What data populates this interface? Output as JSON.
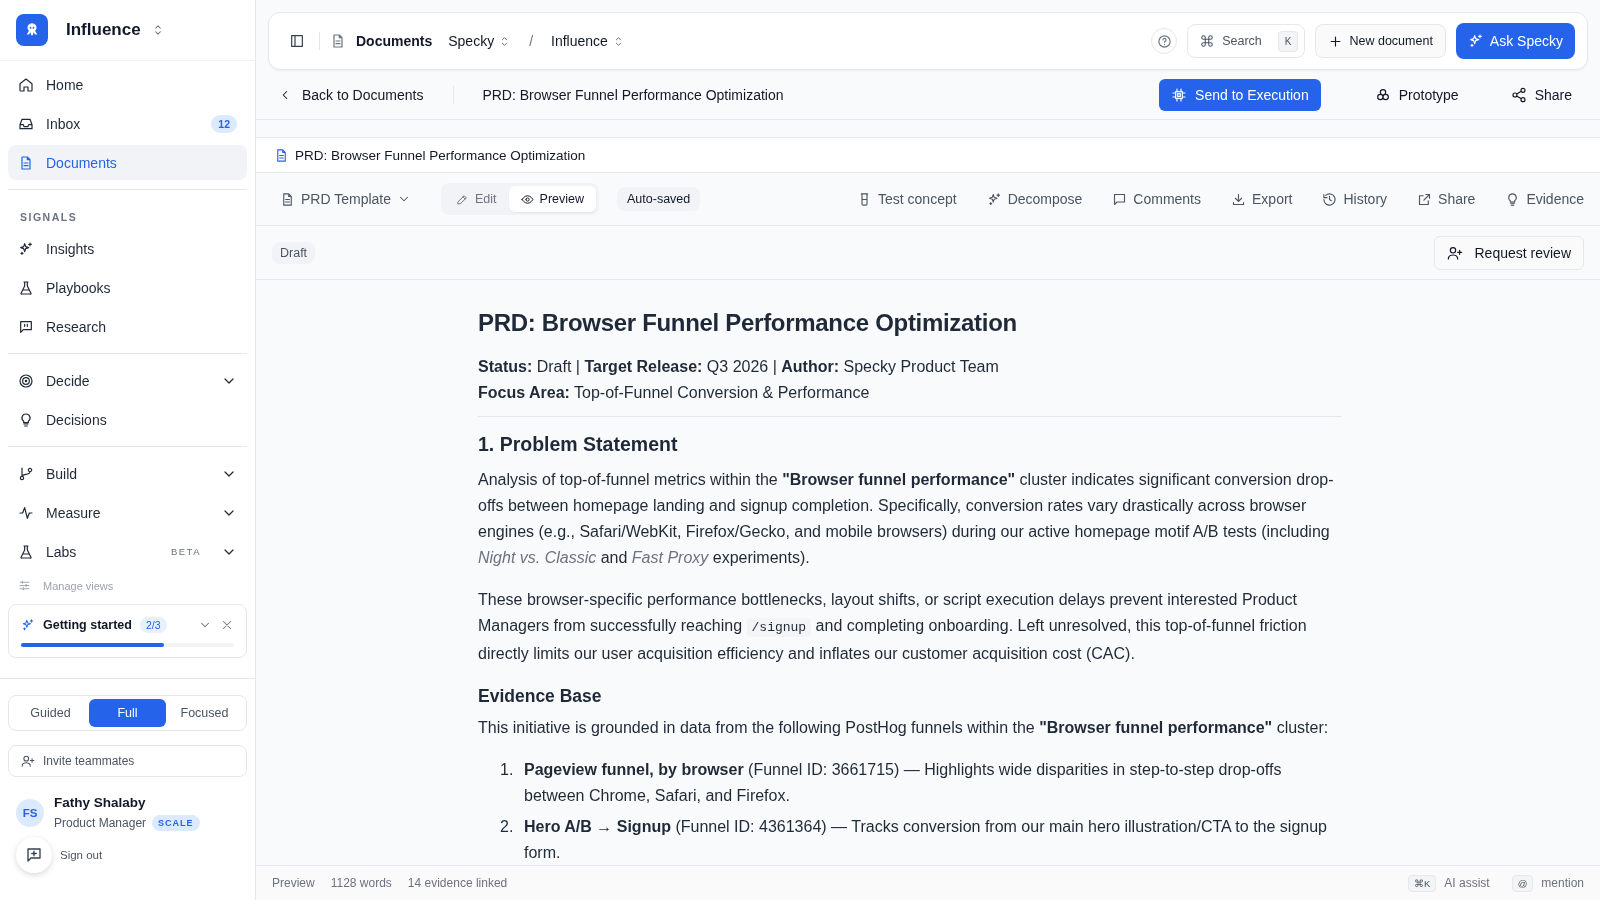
{
  "workspace": {
    "name": "Influence"
  },
  "sidebar": {
    "groups": [
      {
        "items": [
          {
            "label": "Home",
            "selected": false
          },
          {
            "label": "Inbox",
            "selected": false,
            "badge": "12"
          },
          {
            "label": "Documents",
            "selected": true
          }
        ]
      },
      {
        "heading": "SIGNALS",
        "items": [
          {
            "label": "Insights",
            "selected": false
          },
          {
            "label": "Playbooks",
            "selected": false
          },
          {
            "label": "Research",
            "selected": false
          }
        ]
      },
      {
        "items": [
          {
            "label": "Decide",
            "selected": false,
            "expandable": true
          },
          {
            "label": "Decisions",
            "selected": false
          }
        ]
      },
      {
        "items": [
          {
            "label": "Build",
            "selected": false,
            "expandable": true
          },
          {
            "label": "Measure",
            "selected": false,
            "expandable": true
          },
          {
            "label": "Labs",
            "selected": false,
            "expandable": true,
            "tag": "BETA"
          }
        ]
      }
    ],
    "manage_views": "Manage views",
    "getting_started": {
      "title": "Getting started",
      "count": "2/3",
      "level": 0.67
    },
    "view_modes": [
      {
        "label": "Guided",
        "selected": false
      },
      {
        "label": "Full",
        "selected": true
      },
      {
        "label": "Focused",
        "selected": false
      }
    ],
    "invite": "Invite teammates",
    "user": {
      "initials": "FS",
      "name": "Fathy Shalaby",
      "role": "Product Manager",
      "plan": "SCALE"
    },
    "sign_out": "Sign out"
  },
  "topbar": {
    "breadcrumb": [
      {
        "label": "Documents",
        "kind": "root"
      },
      {
        "label": "Specky",
        "kind": "switcher"
      },
      {
        "label": "/",
        "kind": "separator"
      },
      {
        "label": "Influence",
        "kind": "switcher"
      }
    ],
    "search": {
      "label": "Search",
      "key": "K"
    },
    "new_document": "New document",
    "ask": "Ask Specky"
  },
  "subbar": {
    "back": "Back to Documents",
    "title": "PRD: Browser Funnel Performance Optimization",
    "actions": [
      {
        "label": "Send to Execution",
        "kind": "primary"
      },
      {
        "label": "Prototype",
        "kind": "plain"
      },
      {
        "label": "Share",
        "kind": "plain"
      }
    ]
  },
  "document": {
    "title": "PRD: Browser Funnel Performance Optimization",
    "template": "PRD Template",
    "modes": [
      {
        "label": "Edit",
        "selected": false
      },
      {
        "label": "Preview",
        "selected": true
      }
    ],
    "save_state": "Auto-saved",
    "tools": [
      "Test concept",
      "Decompose",
      "Comments",
      "Export",
      "History",
      "Share",
      "Evidence"
    ],
    "status": "Draft",
    "request_review": "Request review",
    "blocks": [
      {
        "kind": "h1",
        "text": "PRD: Browser Funnel Performance Optimization"
      },
      {
        "kind": "meta",
        "lines": [
          "**Status:** Draft | **Target Release:** Q3 2026 | **Author:** Specky Product Team",
          "**Focus Area:** Top-of-Funnel Conversion & Performance"
        ]
      },
      {
        "kind": "rule"
      },
      {
        "kind": "h2",
        "text": "1. Problem Statement"
      },
      {
        "kind": "paragraph",
        "segments": [
          {
            "kind": "text",
            "text": "Analysis of top-of-funnel metrics within the **\"Browser funnel performance\"** cluster indicates significant conversion drop-offs between homepage landing and signup completion. Specifically, conversion rates vary drastically across browser engines (e.g., Safari/WebKit, Firefox/Gecko, and mobile browsers) during our active homepage motif A/B tests (including *Night vs. Classic* and *Fast Proxy* experiments)."
          }
        ]
      },
      {
        "kind": "paragraph",
        "segments": [
          {
            "kind": "text",
            "text": "These browser-specific performance bottlenecks, layout shifts, or script execution delays prevent interested Product Managers from successfully reaching "
          },
          {
            "kind": "code",
            "text": "/signup"
          },
          {
            "kind": "text",
            "text": " and completing onboarding. Left unresolved, this top-of-funnel friction directly limits our user acquisition efficiency and inflates our customer acquisition cost (CAC)."
          }
        ]
      },
      {
        "kind": "h3",
        "text": "Evidence Base"
      },
      {
        "kind": "paragraph",
        "segments": [
          {
            "kind": "text",
            "text": "This initiative is grounded in data from the following PostHog funnels within the **\"Browser funnel performance\"** cluster:"
          }
        ]
      },
      {
        "kind": "list",
        "items": [
          {
            "number": "1.",
            "text": "**Pageview funnel, by browser** (Funnel ID: 3661715) — Highlights wide disparities in step-to-step drop-offs between Chrome, Safari, and Firefox."
          },
          {
            "number": "2.",
            "text": "**Hero A/B → Signup** (Funnel ID: 4361364) — Tracks conversion from our main hero illustration/CTA to the signup form."
          }
        ]
      }
    ]
  },
  "footer": {
    "stats": [
      "Preview",
      "1128 words",
      "14 evidence linked"
    ],
    "hints": [
      {
        "key": "⌘K",
        "label": "AI assist"
      },
      {
        "key": "@",
        "label": "mention"
      }
    ]
  }
}
